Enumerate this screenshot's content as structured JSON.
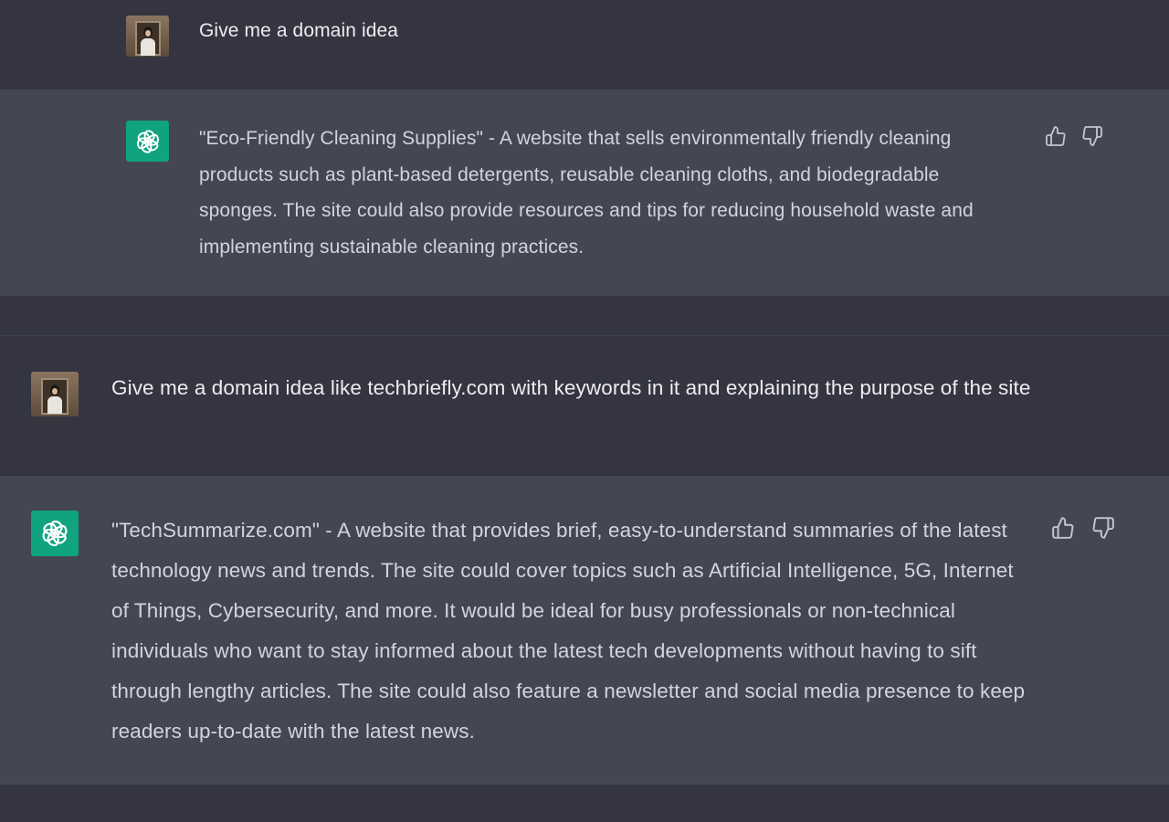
{
  "colors": {
    "user_bg": "#343541",
    "assistant_bg": "#444654",
    "bot_avatar": "#10a37f",
    "user_text": "#ececf1",
    "assistant_text": "#d1d5db",
    "icon": "#c5c5d2"
  },
  "conversation": [
    {
      "role": "user",
      "avatar_icon": "user-photo-avatar",
      "text": "Give me a domain idea"
    },
    {
      "role": "assistant",
      "avatar_icon": "openai-logo-icon",
      "text": "\"Eco-Friendly Cleaning Supplies\" - A website that sells environmentally friendly cleaning products such as plant-based detergents, reusable cleaning cloths, and biodegradable sponges. The site could also provide resources and tips for reducing household waste and implementing sustainable cleaning practices.",
      "actions": [
        "thumbs-up-icon",
        "thumbs-down-icon"
      ]
    },
    {
      "role": "user",
      "avatar_icon": "user-photo-avatar",
      "text": "Give me a domain idea like techbriefly.com with keywords in it and explaining the purpose of the site"
    },
    {
      "role": "assistant",
      "avatar_icon": "openai-logo-icon",
      "text": "\"TechSummarize.com\" - A website that provides brief, easy-to-understand summaries of the latest technology news and trends. The site could cover topics such as Artificial Intelligence, 5G, Internet of Things, Cybersecurity, and more. It would be ideal for busy professionals or non-technical individuals who want to stay informed about the latest tech developments without having to sift through lengthy articles. The site could also feature a newsletter and social media presence to keep readers up-to-date with the latest news.",
      "actions": [
        "thumbs-up-icon",
        "thumbs-down-icon"
      ]
    }
  ]
}
